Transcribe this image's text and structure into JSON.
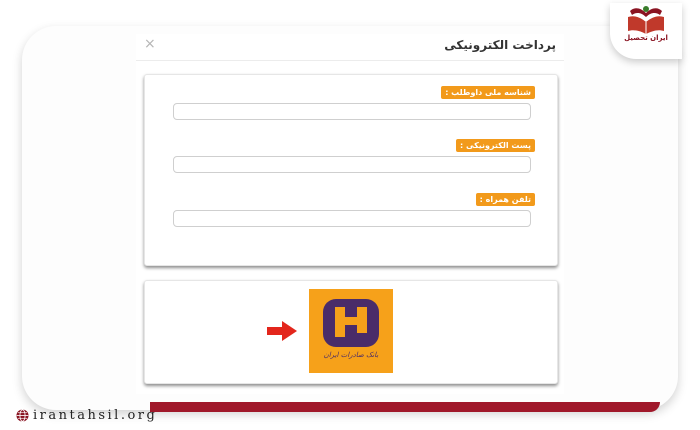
{
  "modal": {
    "title": "پرداخت الکترونیکی",
    "close_label": "×"
  },
  "form": {
    "fields": [
      {
        "label": "شناسه ملی داوطلب :",
        "value": "",
        "placeholder": ""
      },
      {
        "label": "پست الکترونیکی :",
        "value": "",
        "placeholder": ""
      },
      {
        "label": "تلفن همراه :",
        "value": "",
        "placeholder": ""
      }
    ],
    "label_color": "#f29a1b"
  },
  "payment": {
    "bank_name": "بانک صادرات ایران",
    "logo_colors": {
      "background": "#f6a11a",
      "mark": "#4a2c69"
    },
    "arrow_color": "#e3261c",
    "arrow_icon": "arrow-right-icon"
  },
  "branding": {
    "name": "ایران تحصیل",
    "website": "irantahsil.org",
    "accent_color": "#a0182a"
  }
}
